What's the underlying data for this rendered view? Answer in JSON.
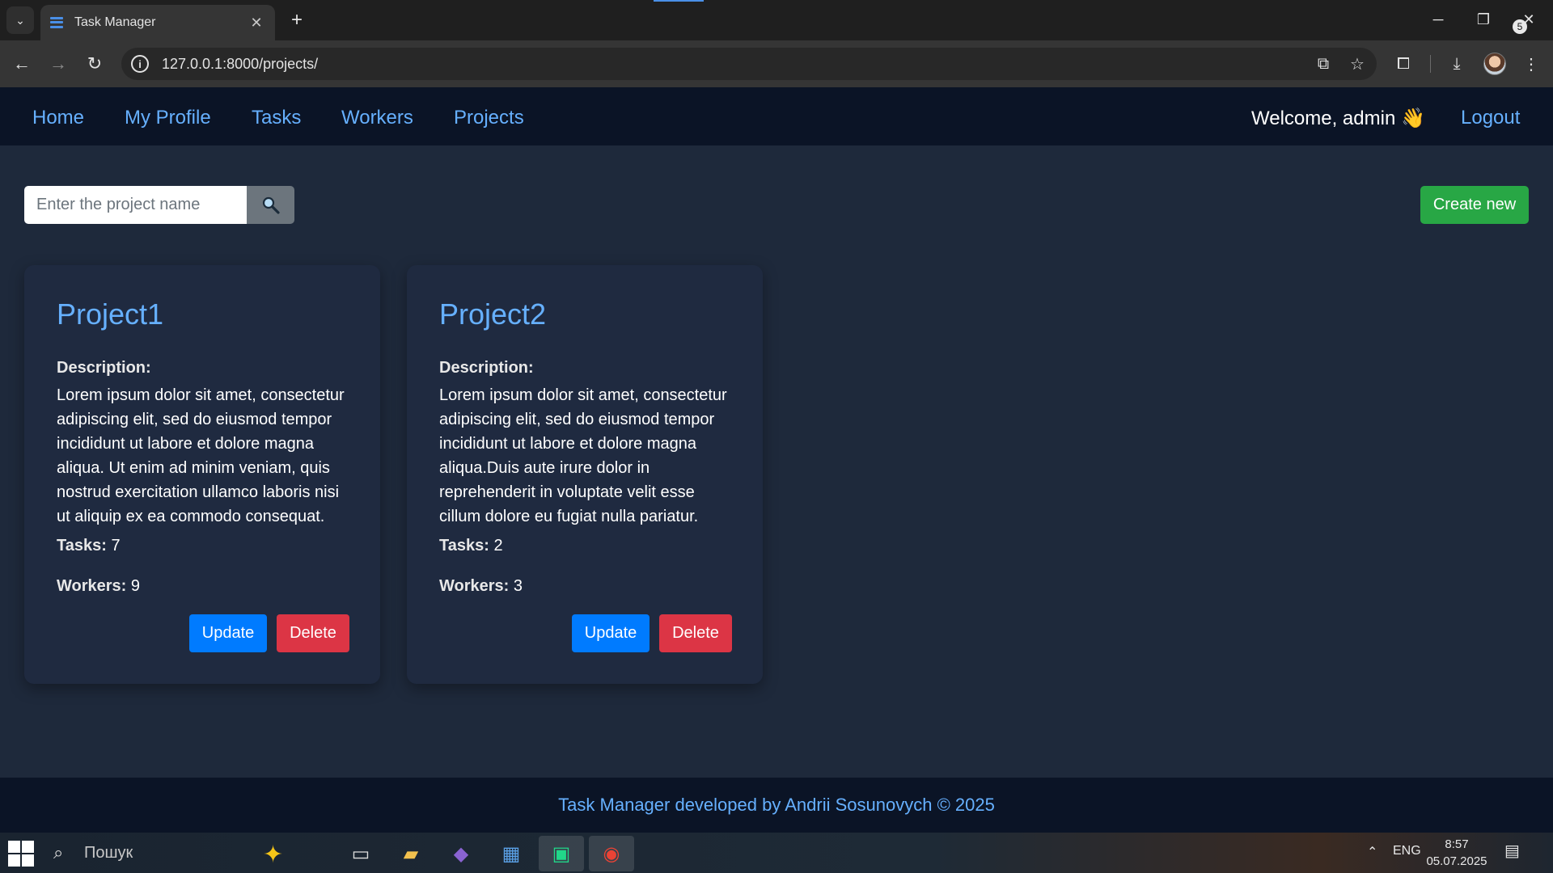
{
  "browser": {
    "tab_title": "Task Manager",
    "url": "127.0.0.1:8000/projects/"
  },
  "navbar": {
    "links": [
      "Home",
      "My Profile",
      "Tasks",
      "Workers",
      "Projects"
    ],
    "welcome": "Welcome, admin 👋",
    "logout": "Logout"
  },
  "search": {
    "placeholder": "Enter the project name"
  },
  "create_label": "Create new",
  "projects": [
    {
      "name": "Project1",
      "description_label": "Description:",
      "description": "Lorem ipsum dolor sit amet, consectetur adipiscing elit, sed do eiusmod tempor incididunt ut labore et dolore magna aliqua. Ut enim ad minim veniam, quis nostrud exercitation ullamco laboris nisi ut aliquip ex ea commodo consequat.",
      "tasks_label": "Tasks:",
      "tasks": "7",
      "workers_label": "Workers:",
      "workers": "9",
      "update_label": "Update",
      "delete_label": "Delete"
    },
    {
      "name": "Project2",
      "description_label": "Description:",
      "description": "Lorem ipsum dolor sit amet, consectetur adipiscing elit, sed do eiusmod tempor incididunt ut labore et dolore magna aliqua.Duis aute irure dolor in reprehenderit in voluptate velit esse cillum dolore eu fugiat nulla pariatur.",
      "tasks_label": "Tasks:",
      "tasks": "2",
      "workers_label": "Workers:",
      "workers": "3",
      "update_label": "Update",
      "delete_label": "Delete"
    }
  ],
  "footer": "Task Manager developed by Andrii Sosunovych © 2025",
  "taskbar": {
    "search_text": "Пошук",
    "language": "ENG",
    "time": "8:57",
    "date": "05.07.2025",
    "notifications": "5"
  },
  "colors": {
    "page_bg": "#1e293b",
    "navbar_bg": "#0b1426",
    "link": "#66b0ff",
    "card_bg": "#1f2a40",
    "primary": "#007bff",
    "danger": "#dc3545",
    "success": "#28a745"
  },
  "icons": {
    "search_button": "magnifier-icon",
    "tab_favicon": "task-manager-favicon"
  }
}
